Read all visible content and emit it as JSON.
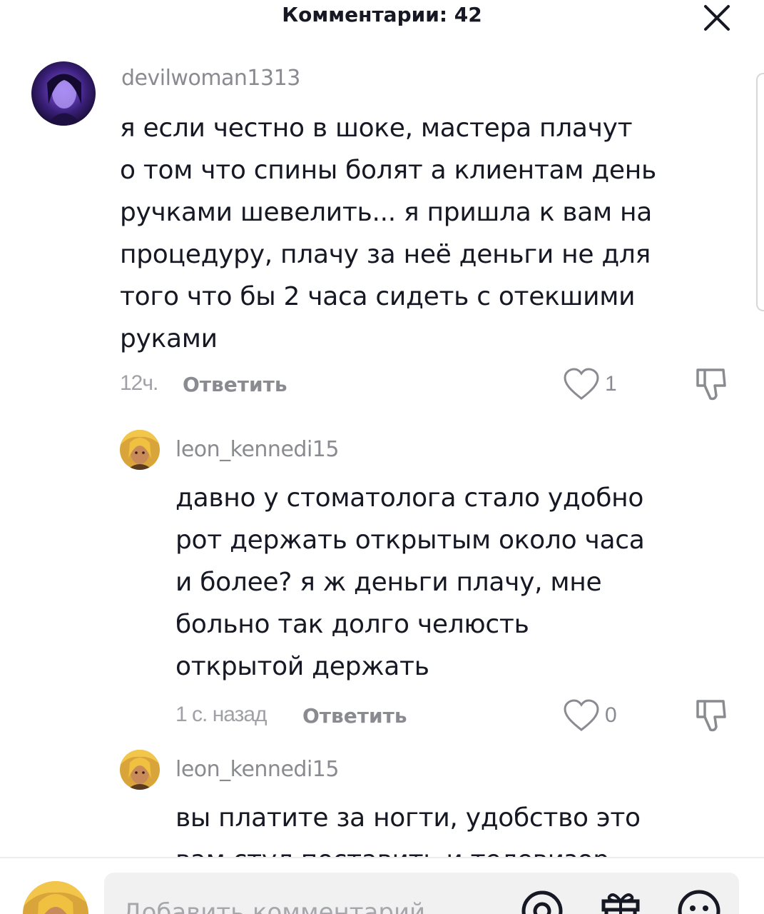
{
  "header": {
    "title": "Комментарии: 42"
  },
  "comments": [
    {
      "username": "devilwoman1313",
      "lines": [
        "я если честно в шоке, мастера плачут",
        "о том что спины болят а клиентам день",
        "ручками шевелить... я пришла к вам на",
        "процедуру, плачу за неё деньги не для",
        "того что бы 2 часа сидеть с отекшими",
        "руками"
      ],
      "time": "12ч.",
      "reply_label": "Ответить",
      "likes": "1"
    },
    {
      "username": "leon_kennedi15",
      "lines": [
        "давно у стоматолога стало удобно",
        "рот держать открытым около часа",
        "и более? я ж деньги плачу, мне",
        "больно так долго челюсть",
        "открытой держать"
      ],
      "time": "1 с. назад",
      "reply_label": "Ответить",
      "likes": "0"
    },
    {
      "username": "leon_kennedi15",
      "lines": [
        "вы платите за ногти, удобство это",
        "вам стул поставить и телевизор"
      ]
    }
  ],
  "composer": {
    "placeholder": "Добавить комментарий..."
  },
  "icons": {
    "close": "close-icon",
    "like": "heart-icon",
    "dislike": "thumbs-down-icon",
    "mention": "at-icon",
    "gift": "gift-icon",
    "emoji": "emoji-icon"
  },
  "colors": {
    "text": "#161823",
    "muted": "#8a8b91",
    "input_bg": "#f1f1f2"
  }
}
